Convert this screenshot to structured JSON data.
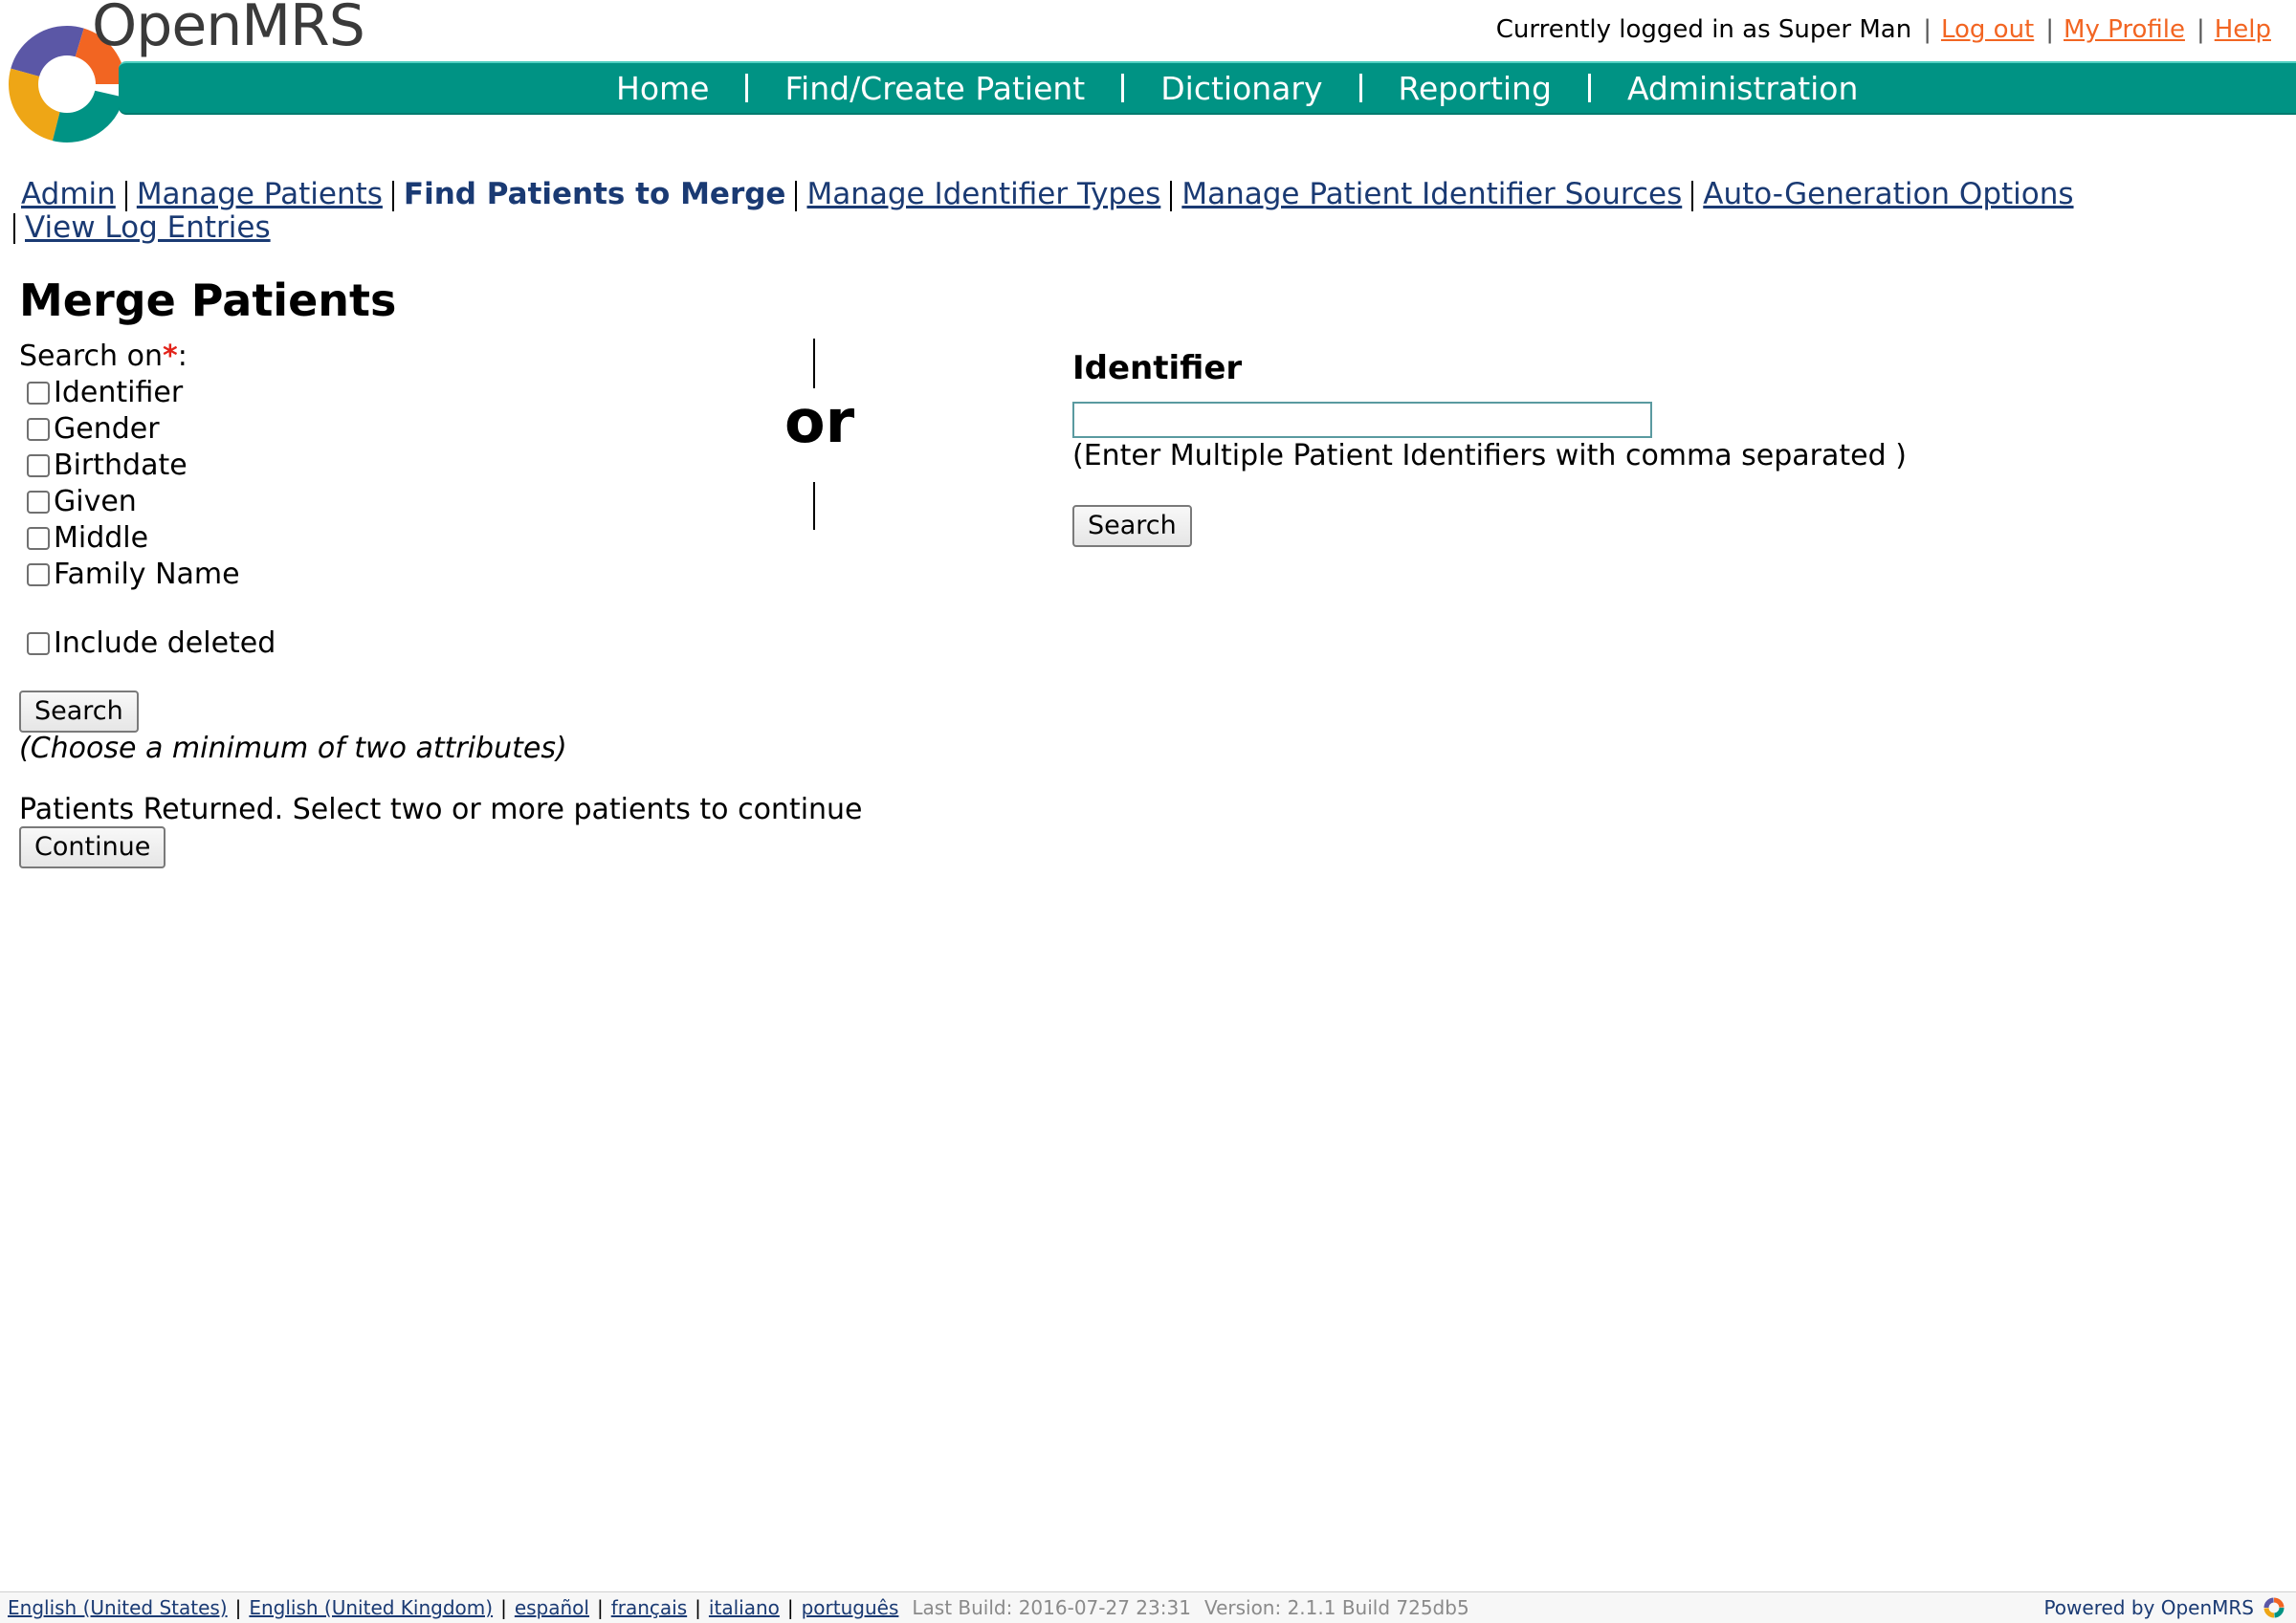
{
  "header": {
    "brand": "OpenMRS",
    "logged_in_text": "Currently logged in as Super Man",
    "logout_label": "Log out",
    "my_profile_label": "My Profile",
    "help_label": "Help",
    "link_color": "#f26522",
    "nav_color": "#009384"
  },
  "nav": {
    "items": [
      "Home",
      "Find/Create Patient",
      "Dictionary",
      "Reporting",
      "Administration"
    ]
  },
  "subnav": {
    "items": [
      "Admin",
      "Manage Patients",
      "Find Patients to Merge",
      "Manage Identifier Types",
      "Manage Patient Identifier Sources",
      "Auto-Generation Options",
      "View Log Entries"
    ],
    "current_index": 2
  },
  "page": {
    "title": "Merge Patients"
  },
  "search_form": {
    "search_on_label": "Search on",
    "required_mark": "*",
    "colon": ":",
    "options": [
      "Identifier",
      "Gender",
      "Birthdate",
      "Given",
      "Middle",
      "Family Name"
    ],
    "include_deleted_label": "Include deleted",
    "search_button": "Search",
    "hint": "(Choose a minimum of two attributes)",
    "returned_text": "Patients Returned. Select two or more patients to continue",
    "continue_button": "Continue"
  },
  "divider": {
    "or_text": "or"
  },
  "identifier_search": {
    "heading": "Identifier",
    "input_value": "",
    "note": "(Enter Multiple Patient Identifiers with comma separated )",
    "search_button": "Search"
  },
  "footer": {
    "languages": [
      "English (United States)",
      "English (United Kingdom)",
      "español",
      "français",
      "italiano",
      "português"
    ],
    "last_build": "Last Build: 2016-07-27 23:31",
    "version": "Version: 2.1.1 Build 725db5",
    "powered_by": "Powered by OpenMRS"
  }
}
